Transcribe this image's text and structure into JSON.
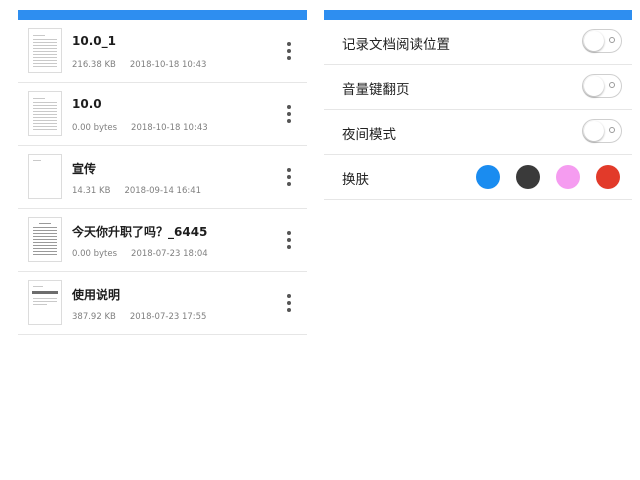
{
  "files": [
    {
      "name": "10.0_1",
      "size": "216.38 KB",
      "date": "2018-10-18 10:43",
      "more_icon": "more-vert-icon"
    },
    {
      "name": "10.0",
      "size": "0.00 bytes",
      "date": "2018-10-18 10:43",
      "more_icon": "more-vert-icon"
    },
    {
      "name": "宣传",
      "size": "14.31 KB",
      "date": "2018-09-14 16:41",
      "more_icon": "more-vert-icon"
    },
    {
      "name": "今天你升职了吗？_6445",
      "size": "0.00 bytes",
      "date": "2018-07-23 18:04",
      "more_icon": "more-vert-icon"
    },
    {
      "name": "使用说明",
      "size": "387.92 KB",
      "date": "2018-07-23 17:55",
      "more_icon": "more-vert-icon"
    }
  ],
  "settings": {
    "record_position": {
      "label": "记录文档阅读位置",
      "enabled": false
    },
    "volume_page_turn": {
      "label": "音量键翻页",
      "enabled": false
    },
    "night_mode": {
      "label": "夜间模式",
      "enabled": false
    },
    "skin": {
      "label": "换肤",
      "colors": [
        "#1a8cf0",
        "#3a3a3a",
        "#f59cf0",
        "#e23a2a"
      ]
    }
  },
  "theme": {
    "topbar": "#2e8ef0"
  }
}
